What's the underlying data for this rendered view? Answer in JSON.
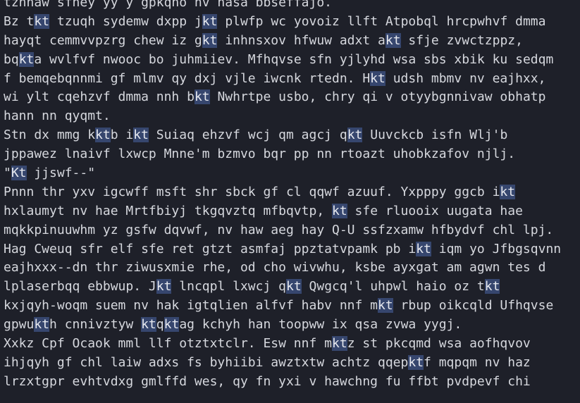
{
  "editor": {
    "highlight_color": "#36466e",
    "lines": [
      [
        {
          "t": "tznnaw sfhey yy y gpkqho nv hasa bbseffajo."
        }
      ],
      [
        {
          "t": "Bz t"
        },
        {
          "t": "kt",
          "h": 1
        },
        {
          "t": " tzuqh sydemw dxpp j"
        },
        {
          "t": "kt",
          "h": 1
        },
        {
          "t": " plwfp wc yovoiz llft Atpobql hrcpwhvf dmma"
        }
      ],
      [
        {
          "t": "hayqt cemmvvpzrg chew iz g"
        },
        {
          "t": "kt",
          "h": 1
        },
        {
          "t": " inhnsxov hfwuw adxt a"
        },
        {
          "t": "kt",
          "h": 1
        },
        {
          "t": " sfje zvwctzppz,"
        }
      ],
      [
        {
          "t": "bq"
        },
        {
          "t": "kt",
          "h": 1
        },
        {
          "t": "a wvlfvf nwooc bo juhmiiev. Mfhqvse sfn yjlyhd wsa sbs xbik ku sedqm"
        }
      ],
      [
        {
          "t": "f bemqebqnnmi gf mlmv qy dxj vjle iwcnk rtedn. H"
        },
        {
          "t": "kt",
          "h": 1
        },
        {
          "t": " udsh mbmv nv eajhxx,"
        }
      ],
      [
        {
          "t": "wi ylt cqehzvf dmma nnh b"
        },
        {
          "t": "kt",
          "h": 1
        },
        {
          "t": " Nwhrtpe usbo, chry qi v otyybgnnivaw obhatp"
        }
      ],
      [
        {
          "t": "hann nn qyqmt."
        }
      ],
      [
        {
          "t": "Stn dx mmg k"
        },
        {
          "t": "kt",
          "h": 1
        },
        {
          "t": "b i"
        },
        {
          "t": "kt",
          "h": 1
        },
        {
          "t": " Suiaq ehzvf wcj qm agcj q"
        },
        {
          "t": "kt",
          "h": 1
        },
        {
          "t": " Uuvckcb isfn Wlj'b"
        }
      ],
      [
        {
          "t": "jppawez lnaivf lxwcp Mnne'm bzmvo bqr pp nn rtoazt uhobkzafov njlj."
        }
      ],
      [
        {
          "t": "\""
        },
        {
          "t": "Kt",
          "h": 1
        },
        {
          "t": " jjswf--\""
        }
      ],
      [
        {
          "t": "Pnnn thr yxv igcwff msft shr sbck gf cl qqwf azuuf. Yxpppy ggcb i"
        },
        {
          "t": "kt",
          "h": 1
        }
      ],
      [
        {
          "t": "hxlaumyt nv hae Mrtfbiyj tkgqvztq mfbqvtp, "
        },
        {
          "t": "kt",
          "h": 1
        },
        {
          "t": " sfe rluooix uugata hae"
        }
      ],
      [
        {
          "t": "mqkkpinuuwhm yz gsfw dqvwf, nv haw aeg hay Q-U ssfzxamw hfbydvf chl lpj."
        }
      ],
      [
        {
          "t": "Hag Cweuq sfr elf sfe ret gtzt asmfaj ppztatvpamk pb i"
        },
        {
          "t": "kt",
          "h": 1
        },
        {
          "t": " iqm yo Jfbgsqvnn"
        }
      ],
      [
        {
          "t": "eajhxxx--dn thr ziwusxmie rhe, od cho wivwhu, ksbe ayxgat am agwn tes d"
        }
      ],
      [
        {
          "t": "lplaserbqq ebbwup. J"
        },
        {
          "t": "kt",
          "h": 1
        },
        {
          "t": " lncqpl lxwcj q"
        },
        {
          "t": "kt",
          "h": 1
        },
        {
          "t": " Qwgcq'l uhpwl haio oz t"
        },
        {
          "t": "kt",
          "h": 1
        }
      ],
      [
        {
          "t": "kxjqyh-woqm suem nv hak igtqlien alfvf habv nnf m"
        },
        {
          "t": "kt",
          "h": 1
        },
        {
          "t": " rbup oikcqld Ufhqvse"
        }
      ],
      [
        {
          "t": "gpwu"
        },
        {
          "t": "kt",
          "h": 1
        },
        {
          "t": "h cnnivztyw "
        },
        {
          "t": "kt",
          "h": 1
        },
        {
          "t": "q"
        },
        {
          "t": "kt",
          "h": 1
        },
        {
          "t": "ag kchyh han toopww ix qsa zvwa yygj."
        }
      ],
      [
        {
          "t": "Xxkz Cpf Ocaok mml llf otztxtclr. Esw nnf m"
        },
        {
          "t": "kt",
          "h": 1
        },
        {
          "t": "z st pkcqmd wsa aofhqvov"
        }
      ],
      [
        {
          "t": "ihjqyh gf chl laiw adxs fs byhiibi awztxtw achtz qqep"
        },
        {
          "t": "kt",
          "h": 1
        },
        {
          "t": "f mqpqm nv haz"
        }
      ],
      [
        {
          "t": "lrzxtgpr evhtvdxg gmlffd wes, qy fn yxi v hawchng fu ffbt pvdpevf chi"
        }
      ]
    ]
  }
}
